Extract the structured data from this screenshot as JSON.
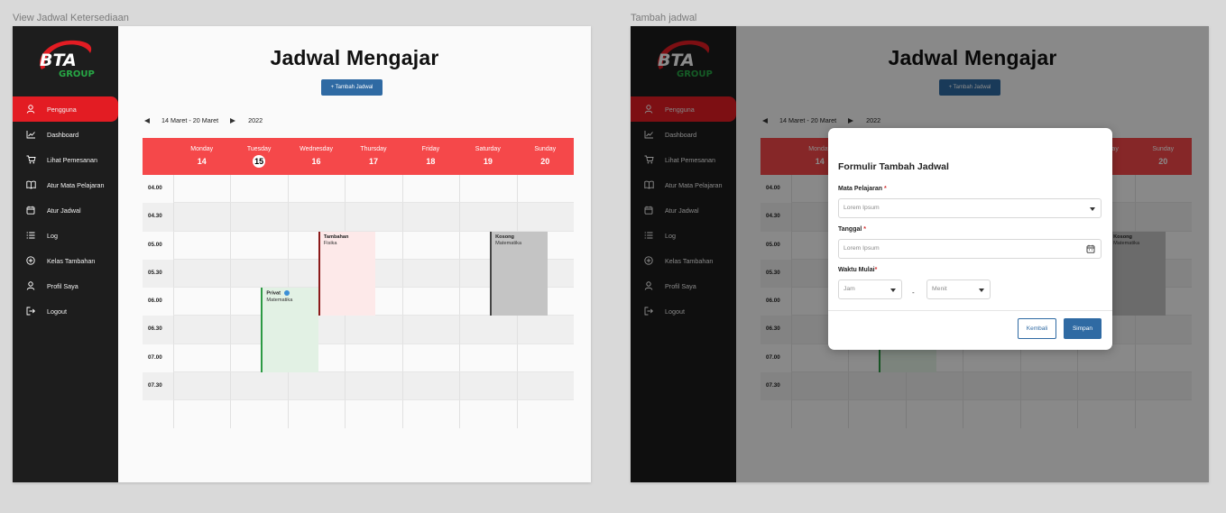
{
  "frames": {
    "view_label": "View Jadwal Ketersediaan",
    "add_label": "Tambah jadwal"
  },
  "brand": {
    "logo_top": "BTA",
    "logo_bottom": "GROUP"
  },
  "sidebar": {
    "items": [
      {
        "label": "Pengguna",
        "icon": "user-icon"
      },
      {
        "label": "Dashboard",
        "icon": "chart-line-icon"
      },
      {
        "label": "Lihat Pemesanan",
        "icon": "cart-icon"
      },
      {
        "label": "Atur Mata Pelajaran",
        "icon": "book-icon"
      },
      {
        "label": "Atur Jadwal",
        "icon": "calendar-icon"
      },
      {
        "label": "Log",
        "icon": "list-icon"
      },
      {
        "label": "Kelas Tambahan",
        "icon": "plus-circle-icon"
      },
      {
        "label": "Profil Saya",
        "icon": "user-icon"
      },
      {
        "label": "Logout",
        "icon": "logout-icon"
      }
    ],
    "active_index": 0
  },
  "header": {
    "title": "Jadwal Mengajar",
    "add_button": "+ Tambah Jadwal"
  },
  "date_nav": {
    "range": "14 Maret - 20 Maret",
    "year": "2022"
  },
  "calendar": {
    "days": [
      {
        "name": "Monday",
        "num": "14"
      },
      {
        "name": "Tuesday",
        "num": "15"
      },
      {
        "name": "Wednesday",
        "num": "16"
      },
      {
        "name": "Thursday",
        "num": "17"
      },
      {
        "name": "Friday",
        "num": "18"
      },
      {
        "name": "Saturday",
        "num": "19"
      },
      {
        "name": "Sunday",
        "num": "20"
      }
    ],
    "today": "15",
    "times": [
      "04.00",
      "04.30",
      "05.00",
      "05.30",
      "06.00",
      "06.30",
      "07.00",
      "07.30"
    ],
    "events": [
      {
        "title": "Tambahan",
        "subject": "Fisika"
      },
      {
        "title": "Kosong",
        "subject": "Matematika"
      },
      {
        "title": "Privat",
        "subject": "Matematika"
      }
    ]
  },
  "modal": {
    "title": "Formulir Tambah Jadwal",
    "subject_label": "Mata Pelajaran",
    "subject_placeholder": "Lorem Ipsum",
    "date_label": "Tanggal",
    "date_placeholder": "Lorem Ipsum",
    "time_label": "Waktu Mulai",
    "hour_placeholder": "Jam",
    "minute_placeholder": "Menit",
    "separator": "-",
    "required_mark": "*",
    "back_button": "Kembali",
    "save_button": "Simpan"
  },
  "colors": {
    "accent_red": "#e31c23",
    "header_red": "#f5484a",
    "primary_blue": "#2f6aa3",
    "sidebar_bg": "#1d1d1d",
    "event_fisika": "#fde9e9",
    "event_kosong": "#c4c4c4",
    "event_privat": "#e2f1e4"
  }
}
